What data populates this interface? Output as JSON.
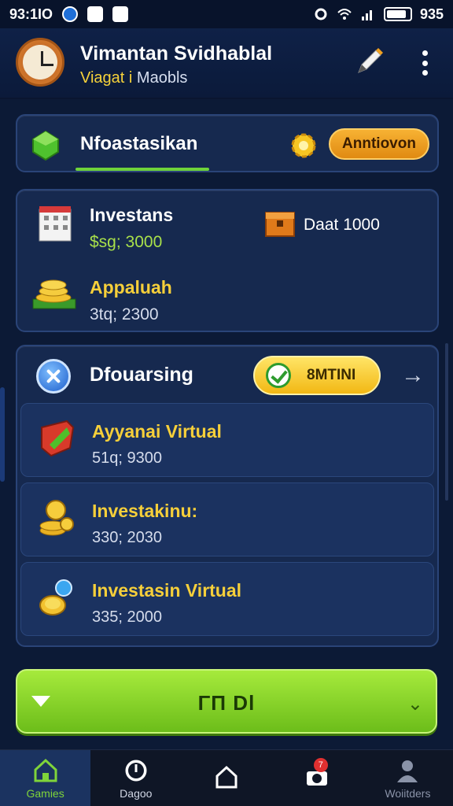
{
  "status_bar": {
    "time": "93:1ΙΟ",
    "right_text": "935"
  },
  "header": {
    "title": "Vimantan Svidhablal",
    "subtitle_accent": "Viagat i",
    "subtitle_rest": "Maobls"
  },
  "tabs_card": {
    "label": "Nfoastasikan",
    "pill_label": "Anntiovon"
  },
  "summary": {
    "item1_title": "Investans",
    "item1_value": "$sg; 3000",
    "item2_label": "Daat 1000",
    "item3_title": "Appaluah",
    "item3_value": "3tq; 2300"
  },
  "list_card": {
    "title": "Dfouarsing",
    "pill_label": "8MTINI",
    "rows": [
      {
        "title": "Ayyanai Virtual",
        "value": "51q; 9300"
      },
      {
        "title": "Investakinu:",
        "value": "330; 2030"
      },
      {
        "title": "Investasin Virtual",
        "value": "335; 2000"
      }
    ]
  },
  "action_button": {
    "label": "ΓΠ Dl"
  },
  "bottom_nav": {
    "items": [
      {
        "label": "Gamies"
      },
      {
        "label": "Dagoo"
      },
      {
        "label": ""
      },
      {
        "label": ""
      },
      {
        "label": "Woiitders"
      }
    ],
    "badge": "7"
  },
  "colors": {
    "background": "#0c1a36",
    "accent_green": "#7fd43a",
    "accent_yellow": "#f6cf3a",
    "accent_orange": "#f0a020"
  }
}
